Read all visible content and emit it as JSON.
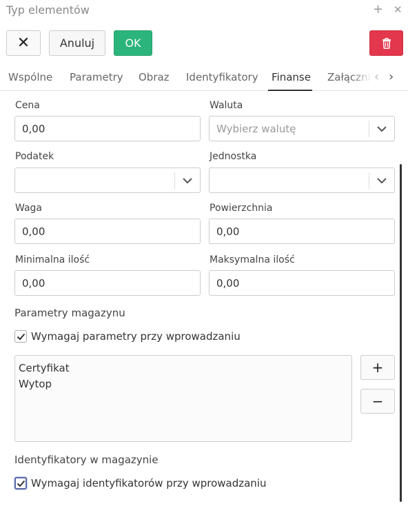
{
  "window": {
    "title": "Typ elementów",
    "add_icon": "plus-icon",
    "close_icon": "close-icon"
  },
  "toolbar": {
    "close_icon": "x-icon",
    "cancel_label": "Anuluj",
    "ok_label": "OK",
    "delete_icon": "trash-icon",
    "ok_color": "#2bb47b",
    "delete_color": "#e2374c"
  },
  "tabs": [
    {
      "label": "Wspólne"
    },
    {
      "label": "Parametry"
    },
    {
      "label": "Obraz"
    },
    {
      "label": "Identyfikatory"
    },
    {
      "label": "Finanse",
      "active": true
    },
    {
      "label": "Załączni"
    }
  ],
  "form": {
    "price": {
      "label": "Cena",
      "value": "0,00"
    },
    "currency": {
      "label": "Waluta",
      "placeholder": "Wybierz walutę"
    },
    "tax": {
      "label": "Podatek",
      "value": ""
    },
    "unit": {
      "label": "Jednostka",
      "value": ""
    },
    "weight": {
      "label": "Waga",
      "value": "0,00"
    },
    "area": {
      "label": "Powierzchnia",
      "value": "0,00"
    },
    "min_qty": {
      "label": "Minimalna ilość",
      "value": "0,00"
    },
    "max_qty": {
      "label": "Maksymalna ilość",
      "value": "0,00"
    }
  },
  "warehouse_params": {
    "title": "Parametry magazynu",
    "checkbox_label": "Wymagaj parametry przy wprowadzaniu",
    "checked": true,
    "items": [
      "Certyfikat",
      "Wytop"
    ],
    "add_label": "+",
    "remove_label": "−"
  },
  "warehouse_ids": {
    "title": "Identyfikatory w magazynie",
    "checkbox_label": "Wymagaj identyfikatorów przy wprowadzaniu",
    "checked": true
  }
}
